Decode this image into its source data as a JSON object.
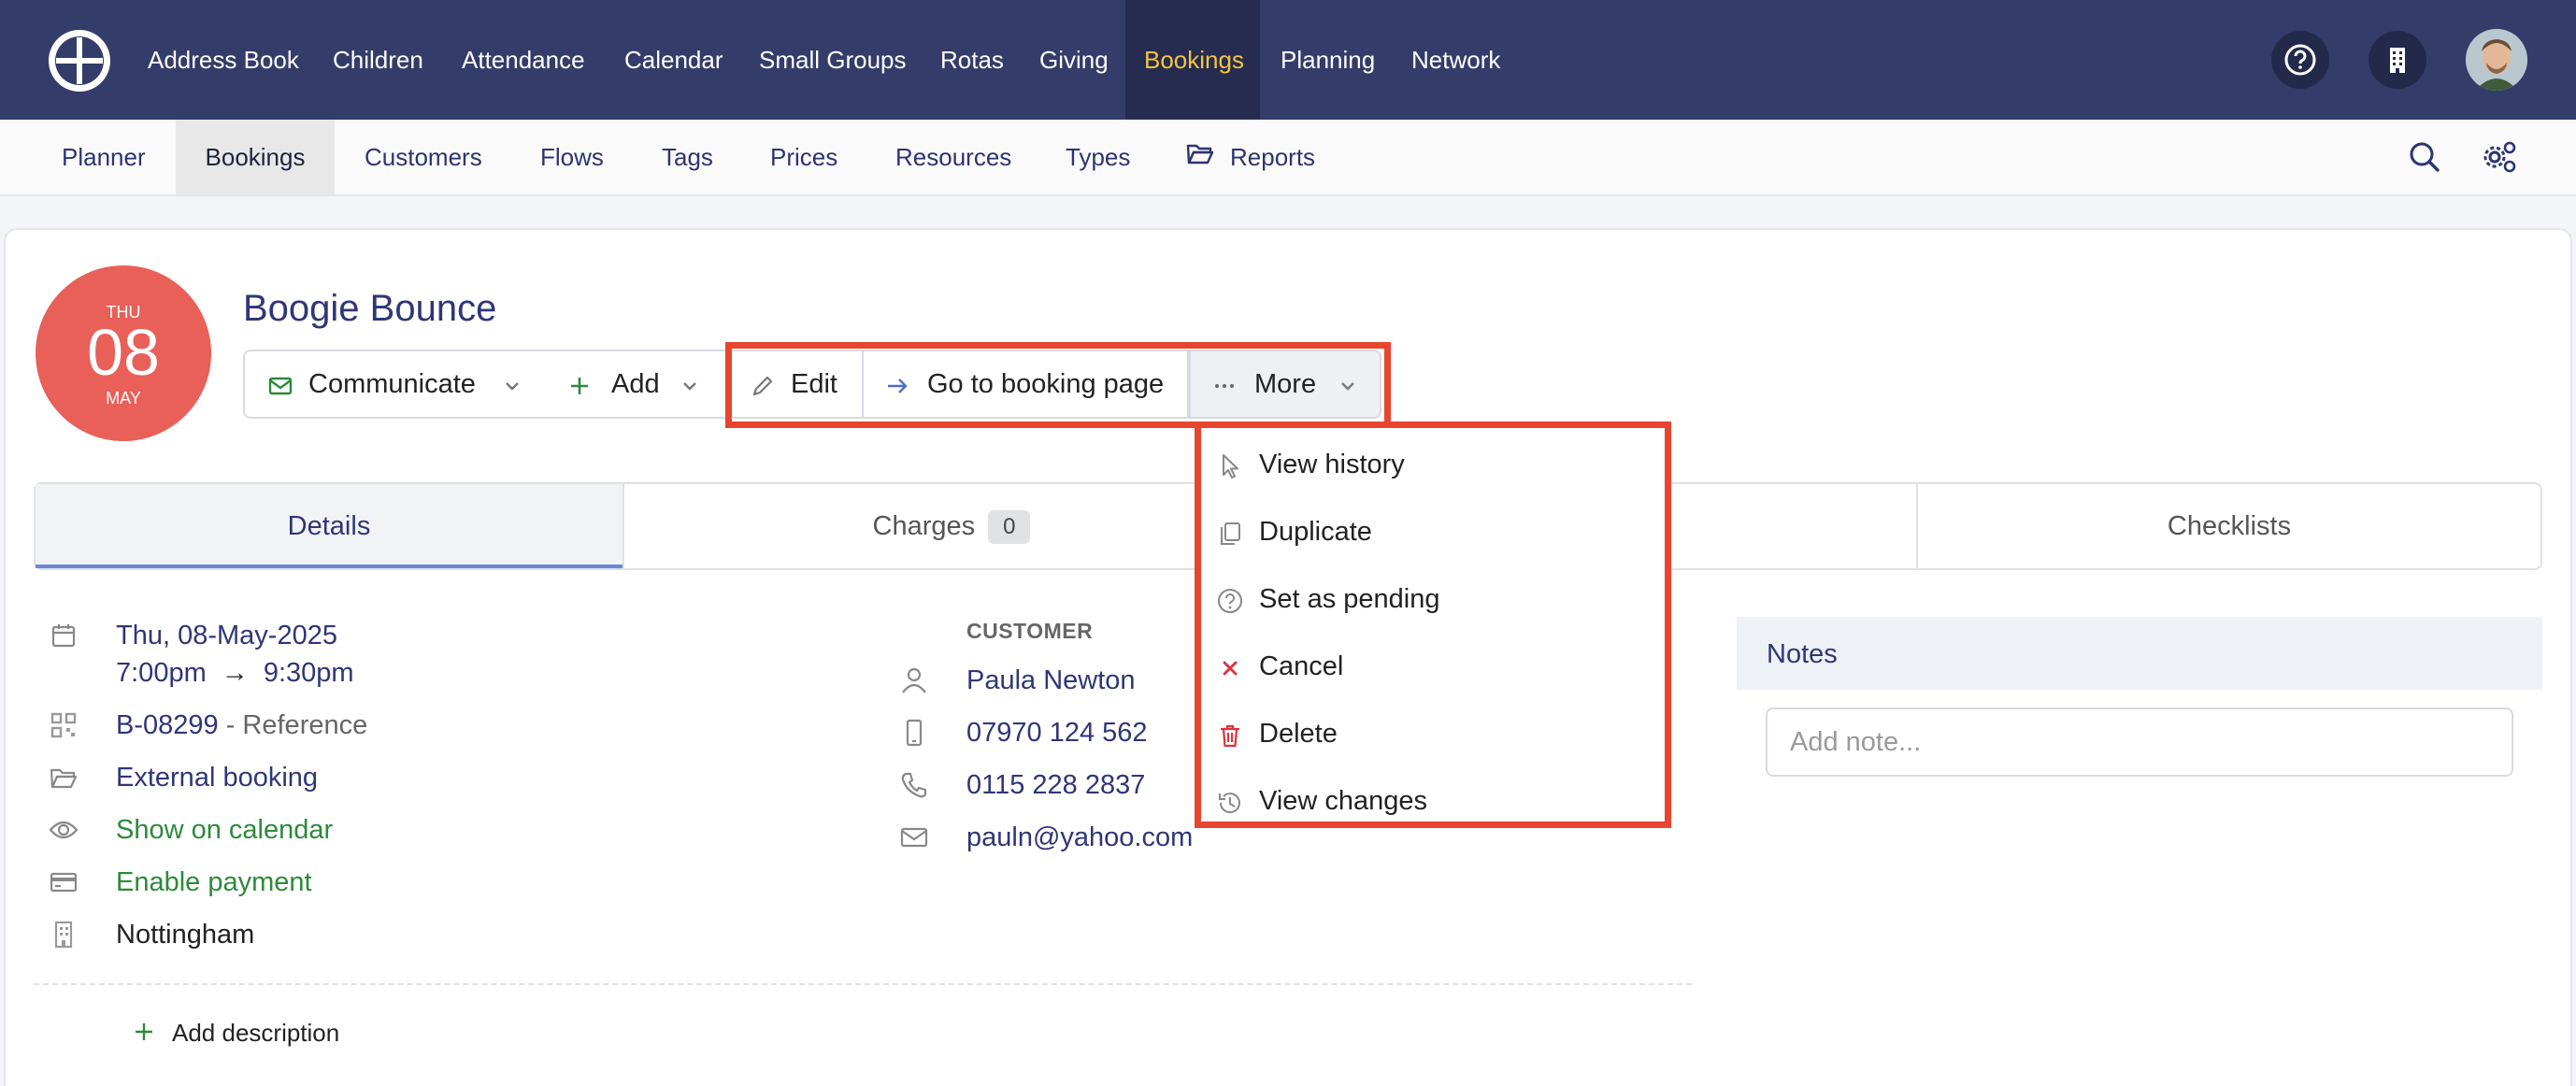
{
  "topnav": {
    "items": [
      "Address Book",
      "Children",
      "Attendance",
      "Calendar",
      "Small Groups",
      "Rotas",
      "Giving",
      "Bookings",
      "Planning",
      "Network"
    ],
    "active": "Bookings",
    "active_color": "#f4c342",
    "bg_color": "#343c6a"
  },
  "subnav": {
    "items": [
      "Planner",
      "Bookings",
      "Customers",
      "Flows",
      "Tags",
      "Prices",
      "Resources",
      "Types",
      "Reports"
    ],
    "active": "Bookings"
  },
  "booking": {
    "date_badge": {
      "dow": "THU",
      "day": "08",
      "month": "MAY",
      "color": "#e86058"
    },
    "title": "Boogie Bounce"
  },
  "toolbar": {
    "communicate": "Communicate",
    "add": "Add",
    "edit": "Edit",
    "goto": "Go to booking page",
    "more": "More"
  },
  "more_menu": {
    "items": [
      {
        "label": "View history",
        "icon": "cursor-icon"
      },
      {
        "label": "Duplicate",
        "icon": "copy-icon"
      },
      {
        "label": "Set as pending",
        "icon": "question-circle-icon"
      },
      {
        "label": "Cancel",
        "icon": "x-icon"
      },
      {
        "label": "Delete",
        "icon": "trash-icon"
      },
      {
        "label": "View changes",
        "icon": "history-icon"
      }
    ],
    "highlight_color": "#e8452e"
  },
  "tabs": {
    "details": "Details",
    "charges": "Charges",
    "charges_count": "0",
    "checklists": "Checklists"
  },
  "details": {
    "date": "Thu, 08-May-2025",
    "time_start": "7:00pm",
    "time_arrow": "→",
    "time_end": "9:30pm",
    "reference_id": "B-08299",
    "reference_label": "- Reference",
    "type": "External booking",
    "calendar": "Show on calendar",
    "payment": "Enable payment",
    "location": "Nottingham"
  },
  "customer": {
    "label": "CUSTOMER",
    "name": "Paula Newton",
    "mobile": "07970 124 562",
    "phone": "0115 228 2837",
    "email": "pauln@yahoo.com"
  },
  "notes": {
    "title": "Notes",
    "placeholder": "Add note..."
  },
  "description": {
    "add_label": "Add description"
  }
}
